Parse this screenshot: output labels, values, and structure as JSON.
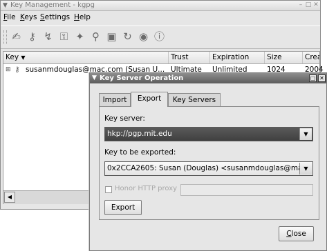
{
  "main_window": {
    "title": "Key Management - kgpg",
    "menu": [
      {
        "label": "File",
        "accel": "F",
        "rest": "ile"
      },
      {
        "label": "Keys",
        "accel": "K",
        "rest": "eys"
      },
      {
        "label": "Settings",
        "accel": "S",
        "rest": "ettings"
      },
      {
        "label": "Help",
        "accel": "H",
        "rest": "elp"
      }
    ],
    "toolbar_icons": [
      "sign-icon",
      "export-key-icon",
      "import-key-icon",
      "keyserver-icon",
      "generate-key-icon",
      "search-icon",
      "photo-icon",
      "refresh-icon",
      "view-icon",
      "info-icon"
    ],
    "columns": {
      "key": "Key",
      "trust": "Trust",
      "expiration": "Expiration",
      "size": "Size",
      "creation": "Creat"
    },
    "row": {
      "text": "susanmdouglas@mac.com (Susan U...",
      "trust": "Ultimate",
      "expiration": "Unlimited",
      "size": "1024",
      "creation": "2004"
    }
  },
  "dialog": {
    "title": "Key Server Operation",
    "tabs": [
      "Import",
      "Export",
      "Key Servers"
    ],
    "active_tab": "Export",
    "key_server_label": "Key server:",
    "key_server_value": "hkp://pgp.mit.edu",
    "key_export_label": "Key to be exported:",
    "key_export_value": "0x2CCA2605: Susan (Douglas) <susanmdouglas@ma",
    "honor_proxy_label": "Honor HTTP proxy",
    "honor_proxy_checked": false,
    "export_button": "Export",
    "close_button": {
      "accel": "C",
      "rest": "lose"
    }
  },
  "colors": {
    "window_bg": "#e6e6e6",
    "dialog_titlebar": "#5c5c5c",
    "selected_combo": "#404040"
  }
}
